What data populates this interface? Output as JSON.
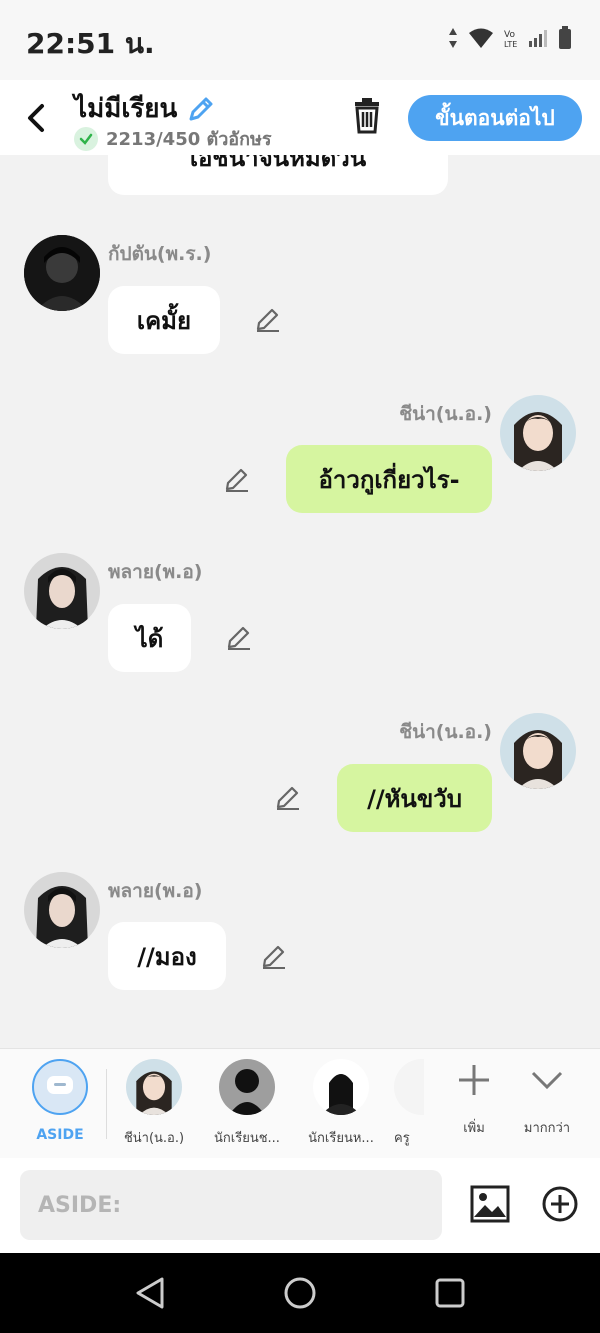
{
  "status": {
    "time": "22:51 น."
  },
  "header": {
    "title": "ไม่มีเรียน",
    "char_count": "2213/450 ตัวอักษร",
    "next_label": "ขั้นตอนต่อไป"
  },
  "messages": [
    {
      "side": "left",
      "text": "เอิชนาจนหมดวัน",
      "partial": true
    },
    {
      "side": "left",
      "name": "กัปตัน(พ.ร.)",
      "text": "เคมั้ย"
    },
    {
      "side": "right",
      "name": "ชีน่า(น.อ.)",
      "text": "อ้าวกูเกี่ยวไร-"
    },
    {
      "side": "left",
      "name": "พลาย(พ.อ)",
      "text": "ได้"
    },
    {
      "side": "right",
      "name": "ชีน่า(น.อ.)",
      "text": "//หันขวับ"
    },
    {
      "side": "left",
      "name": "พลาย(พ.อ)",
      "text": "//มอง"
    }
  ],
  "characters": [
    {
      "label": "ASIDE",
      "icon": "chat-bubble-icon"
    },
    {
      "label": "ชีน่า(น.อ.)"
    },
    {
      "label": "นักเรียนช..."
    },
    {
      "label": "นักเรียนห..."
    },
    {
      "label": "ครู"
    }
  ],
  "tray_actions": {
    "add_label": "เพิ่ม",
    "more_label": "มากกว่า"
  },
  "input": {
    "placeholder": "ASIDE:"
  },
  "colors": {
    "accent": "#4ea3f1",
    "right_bubble": "#d6f5a0",
    "left_bubble": "#ffffff"
  }
}
